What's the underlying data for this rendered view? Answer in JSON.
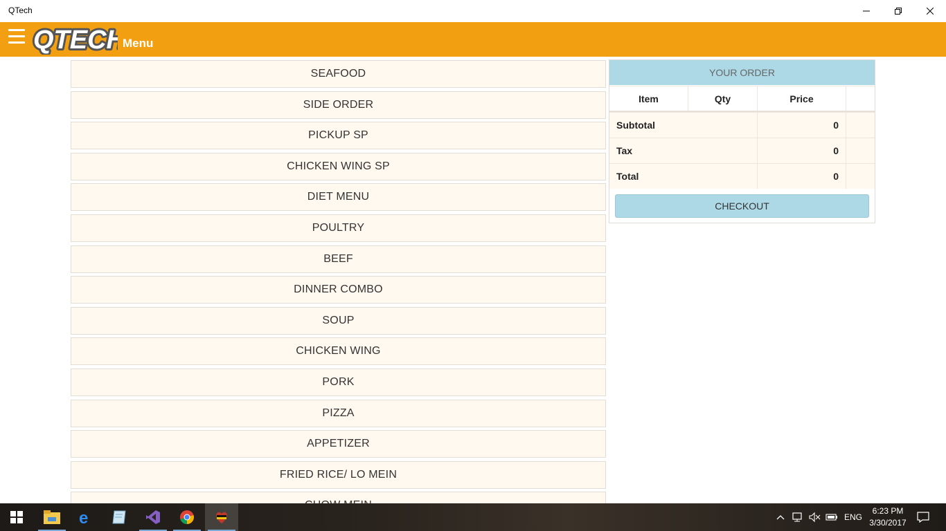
{
  "window": {
    "title": "QTech"
  },
  "app": {
    "logo_text": "QTECH",
    "section_title": "Menu",
    "accent_color": "#f2a011"
  },
  "categories": [
    "SEAFOOD",
    "SIDE ORDER",
    "PICKUP SP",
    "CHICKEN WING SP",
    "DIET MENU",
    "POULTRY",
    "BEEF",
    "DINNER COMBO",
    "SOUP",
    "CHICKEN WING",
    "PORK",
    "PIZZA",
    "APPETIZER",
    "FRIED RICE/ LO MEIN",
    "CHOW MEIN"
  ],
  "order": {
    "header": "YOUR ORDER",
    "header_color": "#add8e6",
    "columns": {
      "item": "Item",
      "qty": "Qty",
      "price": "Price"
    },
    "subtotal_label": "Subtotal",
    "subtotal": "0",
    "tax_label": "Tax",
    "tax": "0",
    "total_label": "Total",
    "total": "0",
    "checkout_label": "CHECKOUT"
  },
  "taskbar": {
    "apps": [
      "windows-start-icon",
      "file-explorer-icon",
      "edge-icon",
      "notepad-icon",
      "visual-studio-icon",
      "chrome-icon",
      "qtech-app-icon"
    ],
    "language": "ENG",
    "time": "6:23 PM",
    "date": "3/30/2017"
  }
}
